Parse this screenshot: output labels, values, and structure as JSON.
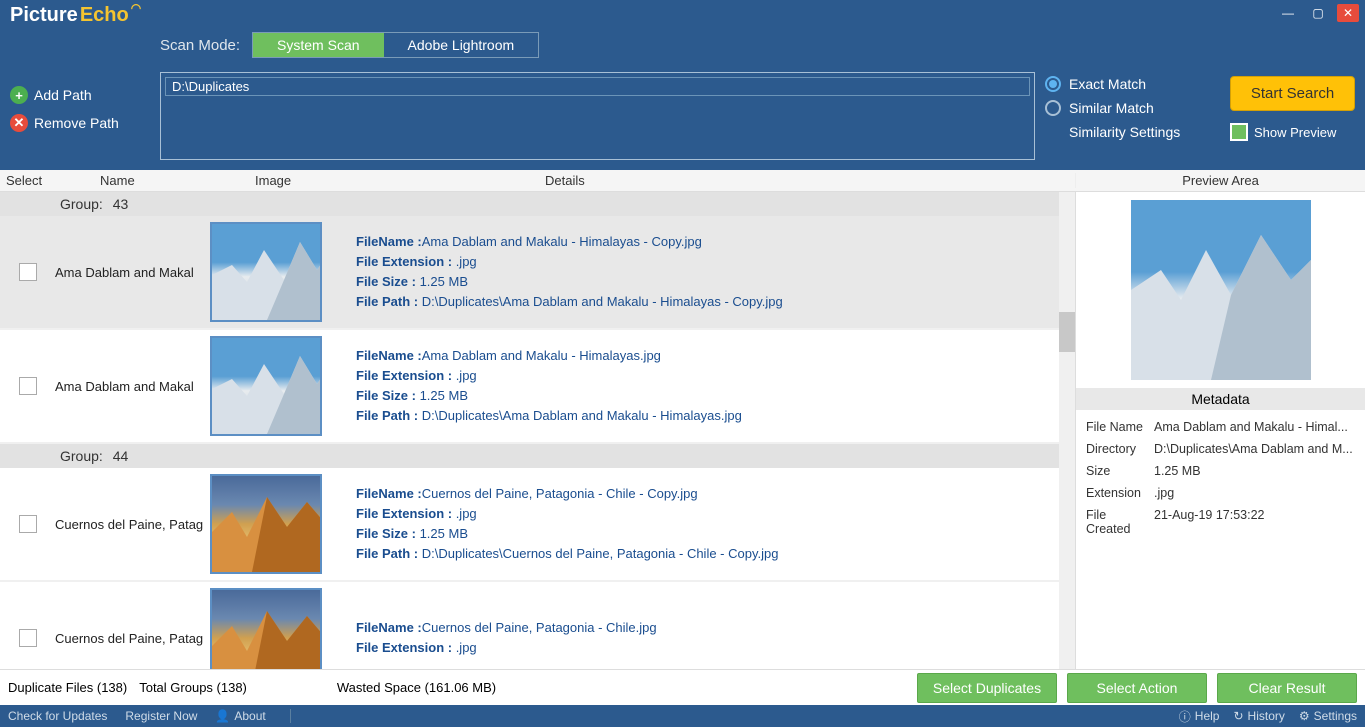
{
  "app": {
    "name_part1": "Picture",
    "name_part2": "Echo"
  },
  "window": {
    "min": "—",
    "max": "▢",
    "close": "✕"
  },
  "header": {
    "scan_mode_label": "Scan Mode:",
    "tab_system": "System Scan",
    "tab_lightroom": "Adobe Lightroom",
    "path_entry": "D:\\Duplicates",
    "add_path": "Add Path",
    "remove_path": "Remove Path",
    "exact_match": "Exact Match",
    "similar_match": "Similar Match",
    "similarity_settings": "Similarity Settings",
    "start_search": "Start Search",
    "show_preview": "Show Preview"
  },
  "columns": {
    "select": "Select",
    "name": "Name",
    "image": "Image",
    "details": "Details",
    "preview": "Preview Area"
  },
  "groups": [
    {
      "label": "Group:",
      "num": "43"
    },
    {
      "label": "Group:",
      "num": "44"
    }
  ],
  "labels": {
    "filename": "FileName :",
    "file_ext": "File Extension : ",
    "file_size": "File Size : ",
    "file_path": "File Path  : "
  },
  "rows": [
    {
      "name": "Ama Dablam and Makal",
      "filename": "Ama Dablam and Makalu - Himalayas - Copy.jpg",
      "ext": ".jpg",
      "size": "1.25 MB",
      "path": "D:\\Duplicates\\Ama Dablam and Makalu - Himalayas - Copy.jpg",
      "thumb_class": "himalaya",
      "selected": true
    },
    {
      "name": "Ama Dablam and Makal",
      "filename": "Ama Dablam and Makalu - Himalayas.jpg",
      "ext": ".jpg",
      "size": "1.25 MB",
      "path": "D:\\Duplicates\\Ama Dablam and Makalu - Himalayas.jpg",
      "thumb_class": "himalaya",
      "selected": false
    },
    {
      "name": "Cuernos del Paine, Patag",
      "filename": "Cuernos del Paine, Patagonia - Chile - Copy.jpg",
      "ext": ".jpg",
      "size": "1.25 MB",
      "path": "D:\\Duplicates\\Cuernos del Paine, Patagonia - Chile - Copy.jpg",
      "thumb_class": "patagonia",
      "selected": false
    },
    {
      "name": "Cuernos del Paine, Patag",
      "filename": "Cuernos del Paine, Patagonia - Chile.jpg",
      "ext": ".jpg",
      "size": "",
      "path": "",
      "thumb_class": "patagonia",
      "selected": false,
      "partial": true
    }
  ],
  "metadata": {
    "header": "Metadata",
    "rows": [
      {
        "k": "File Name",
        "v": "Ama Dablam and Makalu - Himal..."
      },
      {
        "k": "Directory",
        "v": "D:\\Duplicates\\Ama Dablam and M..."
      },
      {
        "k": "Size",
        "v": "1.25 MB"
      },
      {
        "k": "Extension",
        "v": ".jpg"
      },
      {
        "k": "File Created",
        "v": "21-Aug-19 17:53:22"
      }
    ]
  },
  "footer": {
    "dup_files": "Duplicate Files (138)",
    "total_groups": "Total Groups (138)",
    "wasted": "Wasted Space (161.06 MB)",
    "select_dup": "Select Duplicates",
    "select_action": "Select Action",
    "clear_result": "Clear Result"
  },
  "status": {
    "check_updates": "Check for Updates",
    "register": "Register Now",
    "about": "About",
    "help": "Help",
    "history": "History",
    "settings": "Settings"
  }
}
